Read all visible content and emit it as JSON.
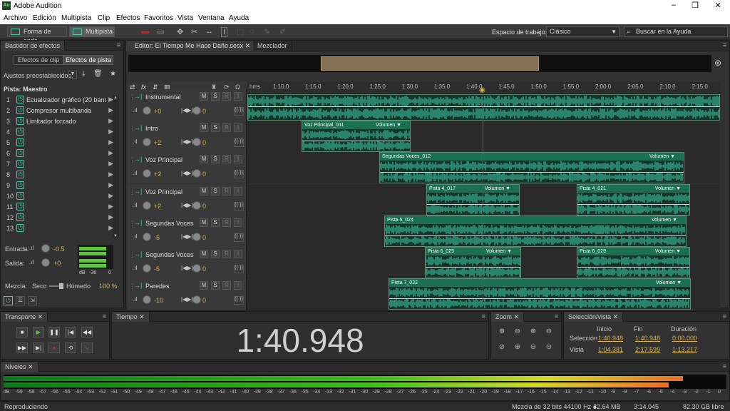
{
  "app": {
    "title": "Adobe Audition",
    "logo": "Au",
    "window_controls": [
      "–",
      "❐",
      "✕"
    ]
  },
  "menu": [
    "Archivo",
    "Edición",
    "Multipista",
    "Clip",
    "Efectos",
    "Favoritos",
    "Vista",
    "Ventana",
    "Ayuda"
  ],
  "toolbar": {
    "waveform_label": "Forma de onda",
    "multitrack_label": "Multipista",
    "workspace_label": "Espacio de trabajo:",
    "workspace_value": "Clásico",
    "search_placeholder": "Buscar en la Ayuda"
  },
  "effects_rack": {
    "title": "Bastidor de efectos",
    "tab_clip": "Efectos de clip",
    "tab_track": "Efectos de pista",
    "presets_label": "Ajustes preestablecidos:",
    "track_label": "Pista: Maestro",
    "slots": [
      {
        "n": "1",
        "name": "Ecualizador gráfico (20 bandas)"
      },
      {
        "n": "2",
        "name": "Compresor multibanda"
      },
      {
        "n": "3",
        "name": "Limitador forzado"
      },
      {
        "n": "4",
        "name": ""
      },
      {
        "n": "5",
        "name": ""
      },
      {
        "n": "6",
        "name": ""
      },
      {
        "n": "7",
        "name": ""
      },
      {
        "n": "8",
        "name": ""
      },
      {
        "n": "9",
        "name": ""
      },
      {
        "n": "10",
        "name": ""
      },
      {
        "n": "11",
        "name": ""
      },
      {
        "n": "12",
        "name": ""
      },
      {
        "n": "13",
        "name": ""
      }
    ],
    "input_label": "Entrada:",
    "input_value": "-0.5",
    "output_label": "Salida:",
    "output_value": "+0",
    "meter_scale": [
      "dB",
      "-36",
      "0"
    ],
    "mix_label": "Mezcla:",
    "dry_label": "Seco",
    "wet_label": "Húmedo",
    "mix_value": "100 %"
  },
  "editor": {
    "tab_label": "Editor: El Tiempo Me Hace Daño.sesx",
    "mixer_tab": "Mezclador",
    "ruler_unit": "hms",
    "ruler_ticks": [
      "1:10.0",
      "1:15.0",
      "1:20.0",
      "1:25.0",
      "1:30.0",
      "1:35.0",
      "1:40.0",
      "1:45.0",
      "1:50.0",
      "1:55.0",
      "2:00.0",
      "2:05.0",
      "2:10.0",
      "2:15.0"
    ],
    "tracks": [
      {
        "name": "Instrumental",
        "volume": "+0",
        "pan": "0",
        "clips": []
      },
      {
        "name": "Intro",
        "volume": "+2",
        "pan": "0",
        "clips": [
          {
            "name": "Voz Principal_011",
            "param": "Volumen"
          }
        ]
      },
      {
        "name": "Voz Principal",
        "volume": "+2",
        "pan": "0",
        "clips": [
          {
            "name": "Segundas Voces_012",
            "param": "Volumen"
          }
        ]
      },
      {
        "name": "Voz Principal",
        "volume": "+2",
        "pan": "0",
        "clips": [
          {
            "name": "Pista 4_017",
            "param": "Volumen"
          },
          {
            "name": "Pista 4_021",
            "param": "Volumen"
          }
        ]
      },
      {
        "name": "Segundas Voces",
        "volume": "-5",
        "pan": "0",
        "clips": [
          {
            "name": "Pista 5_024",
            "param": "Volumen"
          }
        ]
      },
      {
        "name": "Segundas Voces",
        "volume": "-5",
        "pan": "0",
        "clips": [
          {
            "name": "Pista 6_025",
            "param": "Volumen"
          },
          {
            "name": "Pista 6_029",
            "param": "Volumen"
          }
        ]
      },
      {
        "name": "Paredes",
        "volume": "-10",
        "pan": "0",
        "clips": [
          {
            "name": "Pista 7_032",
            "param": "Volumen"
          }
        ]
      }
    ],
    "mute": "M",
    "solo": "S",
    "rec": "R",
    "input_mon": "I"
  },
  "transport": {
    "title": "Transporte"
  },
  "time": {
    "title": "Tiempo",
    "value": "1:40.948"
  },
  "zoom": {
    "title": "Zoom"
  },
  "selection": {
    "title": "Selección/vista",
    "col_start": "Inicio",
    "col_end": "Fin",
    "col_dur": "Duración",
    "row_sel": "Selección",
    "row_view": "Vista",
    "sel_start": "1:40.948",
    "sel_end": "1:40.948",
    "sel_dur": "0:00.000",
    "view_start": "1:04.381",
    "view_end": "2:17.599",
    "view_dur": "1:13.217"
  },
  "levels": {
    "title": "Niveles",
    "scale": [
      "dB",
      "-59",
      "-58",
      "-57",
      "-56",
      "-55",
      "-54",
      "-53",
      "-52",
      "-51",
      "-50",
      "-49",
      "-48",
      "-47",
      "-46",
      "-45",
      "-44",
      "-43",
      "-42",
      "-41",
      "-40",
      "-39",
      "-38",
      "-37",
      "-36",
      "-35",
      "-34",
      "-33",
      "-32",
      "-31",
      "-30",
      "-29",
      "-28",
      "-27",
      "-26",
      "-25",
      "-24",
      "-23",
      "-22",
      "-21",
      "-20",
      "-19",
      "-18",
      "-17",
      "-16",
      "-15",
      "-14",
      "-13",
      "-12",
      "-11",
      "-10",
      "-9",
      "-8",
      "-7",
      "-6",
      "-5",
      "-4",
      "-3",
      "-2",
      "-1",
      "0"
    ],
    "left_level": 0.94,
    "right_level": 0.92
  },
  "status": {
    "state": "Reproduciendo",
    "format": "Mezcla de 32 bits 44100 Hz ●",
    "size": "32.64 MB",
    "duration": "3:14.045",
    "free": "82.30 GB libre"
  },
  "colors": {
    "accent": "#3fd3b0",
    "clip_header": "#1b6f53",
    "waveform": "#3fd3b0",
    "playhead": "#d23a2a",
    "value": "#ddb44a"
  }
}
